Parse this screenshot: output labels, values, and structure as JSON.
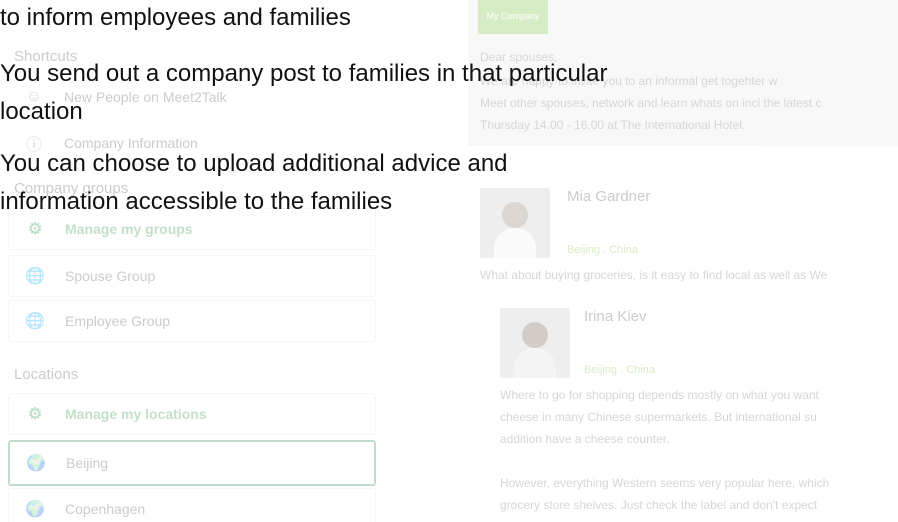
{
  "sidebar": {
    "shortcuts_header": "Shortcuts",
    "shortcuts": [
      {
        "label": "New People on Meet2Talk",
        "icon": "people-icon"
      },
      {
        "label": "Company Information",
        "icon": "info-icon"
      }
    ],
    "groups_header": "Company groups",
    "groups": [
      {
        "label": "Manage my groups",
        "icon": "gear-icon"
      },
      {
        "label": "Spouse Group",
        "icon": "globe-icon"
      },
      {
        "label": "Employee Group",
        "icon": "globe-icon"
      }
    ],
    "locations_header": "Locations",
    "locations": [
      {
        "label": "Manage my locations",
        "icon": "gear-icon"
      },
      {
        "label": "Beijing",
        "icon": "location-icon"
      },
      {
        "label": "Copenhagen",
        "icon": "location-icon"
      }
    ]
  },
  "feed": {
    "company_badge": "My Company",
    "post": {
      "greeting": "Dear spouses,",
      "line1": "We are happy to invite you to an informal get togehter w",
      "line2": "Meet other spouses, network and learn whats on incl the latest c",
      "line3": "Thursday 14.00 - 16.00 at The International Hotel."
    },
    "comments": [
      {
        "author": "Mia Gardner",
        "location": "Beijing . China",
        "text": [
          "What about buying groceries, is it easy to find local as well as We"
        ]
      },
      {
        "author": "Irina Kiev",
        "location": "Beijing . China",
        "text": [
          "Where to go for shopping depends mostly on what you want",
          "cheese in many Chinese supermarkets. But international su",
          "addition have a cheese counter.",
          "",
          "However, everything Western seems very popular here, which",
          "grocery store shelves. Just check the label and don't expect"
        ]
      }
    ]
  },
  "overlay": {
    "lines": [
      "to inform employees and families",
      "You send out a company post to families in that particular",
      "location",
      "You can choose to upload additional advice and",
      "information accessible to the families"
    ]
  }
}
